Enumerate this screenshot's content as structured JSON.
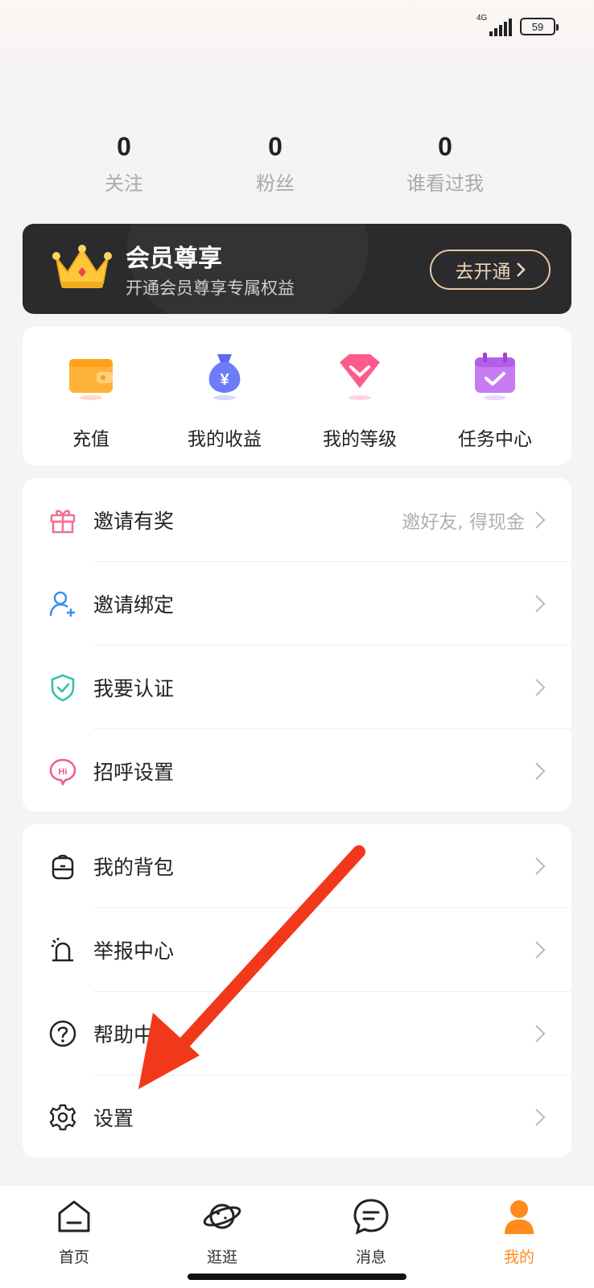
{
  "status_bar": {
    "network": "4G",
    "battery": "59"
  },
  "stats": [
    {
      "value": "0",
      "label": "关注"
    },
    {
      "value": "0",
      "label": "粉丝"
    },
    {
      "value": "0",
      "label": "谁看过我"
    }
  ],
  "vip": {
    "title": "会员尊享",
    "subtitle": "开通会员尊享专属权益",
    "button": "去开通"
  },
  "quick_actions": [
    {
      "label": "充值",
      "icon": "wallet-icon"
    },
    {
      "label": "我的收益",
      "icon": "money-bag-icon"
    },
    {
      "label": "我的等级",
      "icon": "diamond-icon"
    },
    {
      "label": "任务中心",
      "icon": "calendar-check-icon"
    }
  ],
  "menu_group_1": [
    {
      "label": "邀请有奖",
      "hint": "邀好友, 得现金",
      "icon": "gift-icon"
    },
    {
      "label": "邀请绑定",
      "hint": "",
      "icon": "add-user-icon"
    },
    {
      "label": "我要认证",
      "hint": "",
      "icon": "shield-check-icon"
    },
    {
      "label": "招呼设置",
      "hint": "",
      "icon": "hi-bubble-icon"
    }
  ],
  "menu_group_2": [
    {
      "label": "我的背包",
      "icon": "backpack-icon"
    },
    {
      "label": "举报中心",
      "icon": "alarm-icon"
    },
    {
      "label": "帮助中心",
      "icon": "help-icon"
    },
    {
      "label": "设置",
      "icon": "gear-icon"
    }
  ],
  "bottom_nav": [
    {
      "label": "首页",
      "icon": "home-icon"
    },
    {
      "label": "逛逛",
      "icon": "planet-icon"
    },
    {
      "label": "消息",
      "icon": "message-icon"
    },
    {
      "label": "我的",
      "icon": "profile-icon",
      "active": true
    }
  ],
  "colors": {
    "accent": "#ff8a1d",
    "annotation": "#f2381b",
    "vip_bg": "#2b2b2e",
    "vip_gold": "#e8c7a3"
  }
}
